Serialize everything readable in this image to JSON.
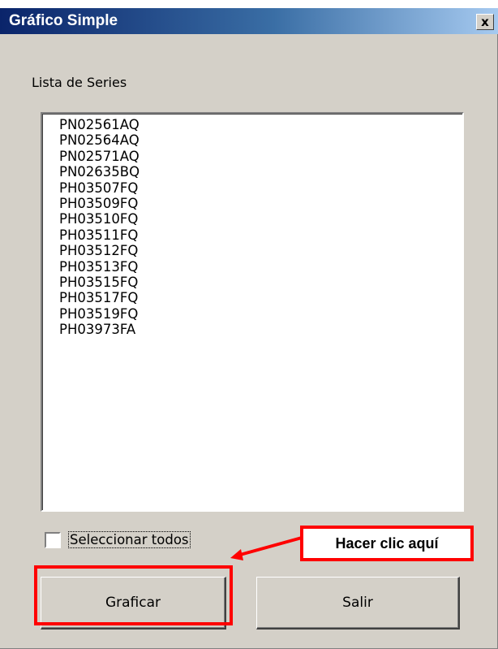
{
  "window": {
    "title": "Gráfico Simple",
    "close_glyph": "x"
  },
  "series_list": {
    "label": "Lista de Series",
    "items": [
      "PN02561AQ",
      "PN02564AQ",
      "PN02571AQ",
      "PN02635BQ",
      "PH03507FQ",
      "PH03509FQ",
      "PH03510FQ",
      "PH03511FQ",
      "PH03512FQ",
      "PH03513FQ",
      "PH03515FQ",
      "PH03517FQ",
      "PH03519FQ",
      "PH03973FA"
    ]
  },
  "select_all": {
    "label": "Seleccionar todos",
    "checked": false
  },
  "buttons": {
    "graficar_label": "Graficar",
    "salir_label": "Salir"
  },
  "annotation": {
    "callout_text": "Hacer clic aquí",
    "color": "#ff0000"
  },
  "colors": {
    "title_bar_start": "#0a246a",
    "title_bar_end": "#a6caf0",
    "window_bg": "#d4d0c8"
  }
}
